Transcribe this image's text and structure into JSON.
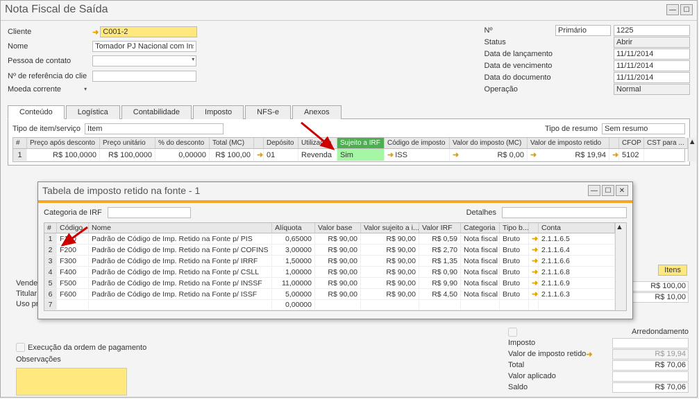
{
  "window": {
    "title": "Nota Fiscal de Saída"
  },
  "header_left": {
    "cliente_lbl": "Cliente",
    "cliente_val": "C001-2",
    "nome_lbl": "Nome",
    "nome_val": "Tomador PJ Nacional com Insc.",
    "contato_lbl": "Pessoa de contato",
    "contato_val": "",
    "ref_lbl": "Nº de referência do clie",
    "ref_val": "",
    "moeda_lbl": "Moeda corrente",
    "moeda_val": ""
  },
  "header_right": {
    "num_lbl": "Nº",
    "num_serie": "Primário",
    "num_val": "1225",
    "status_lbl": "Status",
    "status_val": "Abrir",
    "lanc_lbl": "Data de lançamento",
    "lanc_val": "11/11/2014",
    "venc_lbl": "Data de vencimento",
    "venc_val": "11/11/2014",
    "doc_lbl": "Data do documento",
    "doc_val": "11/11/2014",
    "oper_lbl": "Operação",
    "oper_val": "Normal"
  },
  "tabs": [
    "Conteúdo",
    "Logística",
    "Contabilidade",
    "Imposto",
    "NFS-e",
    "Anexos"
  ],
  "content": {
    "tipo_item_lbl": "Tipo de item/serviço",
    "tipo_item_val": "Item",
    "tipo_resumo_lbl": "Tipo de resumo",
    "tipo_resumo_val": "Sem resumo",
    "grid_headers": [
      "#",
      "Preço após desconto",
      "Preço unitário",
      "% do desconto",
      "Total (MC)",
      "",
      "Depósito",
      "Utilização",
      "Sujeito a IRF",
      "Código de imposto",
      "Valor do imposto (MC)",
      "Valor de imposto retido",
      "",
      "CFOP",
      "CST para ..."
    ],
    "grid_row": {
      "n": "1",
      "apos": "R$ 100,0000",
      "unit": "R$ 100,0000",
      "desc": "0,00000",
      "total": "R$ 100,00",
      "dep": "01",
      "util": "Revenda",
      "irf": "Sim",
      "cod": "ISS",
      "valimp": "R$ 0,00",
      "valret": "R$ 19,94",
      "cfop": "5102",
      "cst": ""
    }
  },
  "modal": {
    "title": "Tabela de imposto retido na fonte - 1",
    "cat_irf_lbl": "Categoria de IRF",
    "detalhes_lbl": "Detalhes",
    "headers": [
      "#",
      "Código",
      "Nome",
      "Alíquota",
      "Valor base",
      "Valor sujeito a i...",
      "Valor IRF",
      "Categoria",
      "Tipo b...",
      "",
      "Conta"
    ],
    "rows": [
      {
        "n": "1",
        "cod": "F100",
        "nome": "Padrão de Código de Imp. Retido na Fonte p/ PIS",
        "aliq": "0,65000",
        "base": "R$ 90,00",
        "suj": "R$ 90,00",
        "irf": "R$ 0,59",
        "cat": "Nota fiscal",
        "tipo": "Bruto",
        "conta": "2.1.1.6.5"
      },
      {
        "n": "2",
        "cod": "F200",
        "nome": "Padrão de Código de Imp. Retido na Fonte p/ COFINS",
        "aliq": "3,00000",
        "base": "R$ 90,00",
        "suj": "R$ 90,00",
        "irf": "R$ 2,70",
        "cat": "Nota fiscal",
        "tipo": "Bruto",
        "conta": "2.1.1.6.4"
      },
      {
        "n": "3",
        "cod": "F300",
        "nome": "Padrão de Código de Imp. Retido na Fonte p/ IRRF",
        "aliq": "1,50000",
        "base": "R$ 90,00",
        "suj": "R$ 90,00",
        "irf": "R$ 1,35",
        "cat": "Nota fiscal",
        "tipo": "Bruto",
        "conta": "2.1.1.6.6"
      },
      {
        "n": "4",
        "cod": "F400",
        "nome": "Padrão de Código de Imp. Retido na Fonte p/ CSLL",
        "aliq": "1,00000",
        "base": "R$ 90,00",
        "suj": "R$ 90,00",
        "irf": "R$ 0,90",
        "cat": "Nota fiscal",
        "tipo": "Bruto",
        "conta": "2.1.1.6.8"
      },
      {
        "n": "5",
        "cod": "F500",
        "nome": "Padrão de Código de Imp. Retido na Fonte p/ INSSF",
        "aliq": "11,00000",
        "base": "R$ 90,00",
        "suj": "R$ 90,00",
        "irf": "R$ 9,90",
        "cat": "Nota fiscal",
        "tipo": "Bruto",
        "conta": "2.1.1.6.9"
      },
      {
        "n": "6",
        "cod": "F600",
        "nome": "Padrão de Código de Imp. Retido na Fonte p/ ISSF",
        "aliq": "5,00000",
        "base": "R$ 90,00",
        "suj": "R$ 90,00",
        "irf": "R$ 4,50",
        "cat": "Nota fiscal",
        "tipo": "Bruto",
        "conta": "2.1.1.6.3"
      },
      {
        "n": "7",
        "cod": "",
        "nome": "",
        "aliq": "0,00000",
        "base": "",
        "suj": "",
        "irf": "",
        "cat": "",
        "tipo": "",
        "conta": ""
      }
    ]
  },
  "left_fields": {
    "vendedor": "Vendedo",
    "titular": "Titular",
    "uso": "Uso prin"
  },
  "itens_btn": "Itens",
  "exec_ordem": "Execução da ordem de pagamento",
  "obs_lbl": "Observações",
  "totals": {
    "r1": "R$ 100,00",
    "r2": "R$ 10,00",
    "arred": "Arredondamento",
    "imposto_lbl": "Imposto",
    "imposto_val": "",
    "retido_lbl": "Valor de imposto retido",
    "retido_val": "R$ 19,94",
    "total_lbl": "Total",
    "total_val": "R$ 70,06",
    "aplic_lbl": "Valor aplicado",
    "aplic_val": "",
    "saldo_lbl": "Saldo",
    "saldo_val": "R$ 70,06"
  }
}
